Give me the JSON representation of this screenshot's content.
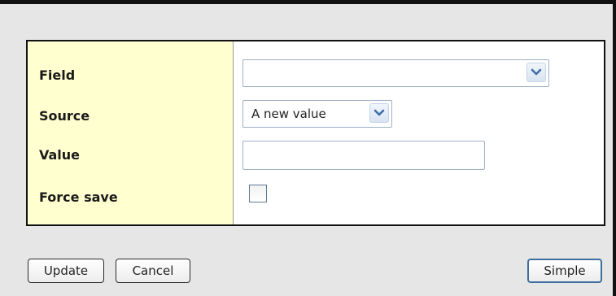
{
  "form": {
    "labels": {
      "field": "Field",
      "source": "Source",
      "value": "Value",
      "force_save": "Force save"
    },
    "field_select": {
      "selected": ""
    },
    "source_select": {
      "selected": "A new value"
    },
    "value_input": {
      "value": ""
    },
    "force_save_checked": false
  },
  "buttons": {
    "update": "Update",
    "cancel": "Cancel",
    "simple": "Simple"
  },
  "colors": {
    "label_column_bg": "#ffffd0",
    "dialog_bg": "#e6e6e6",
    "control_border": "#9db0c8",
    "dropdown_arrow": "#3c6ea8"
  },
  "icons": {
    "dropdown": "chevron-down-icon"
  }
}
